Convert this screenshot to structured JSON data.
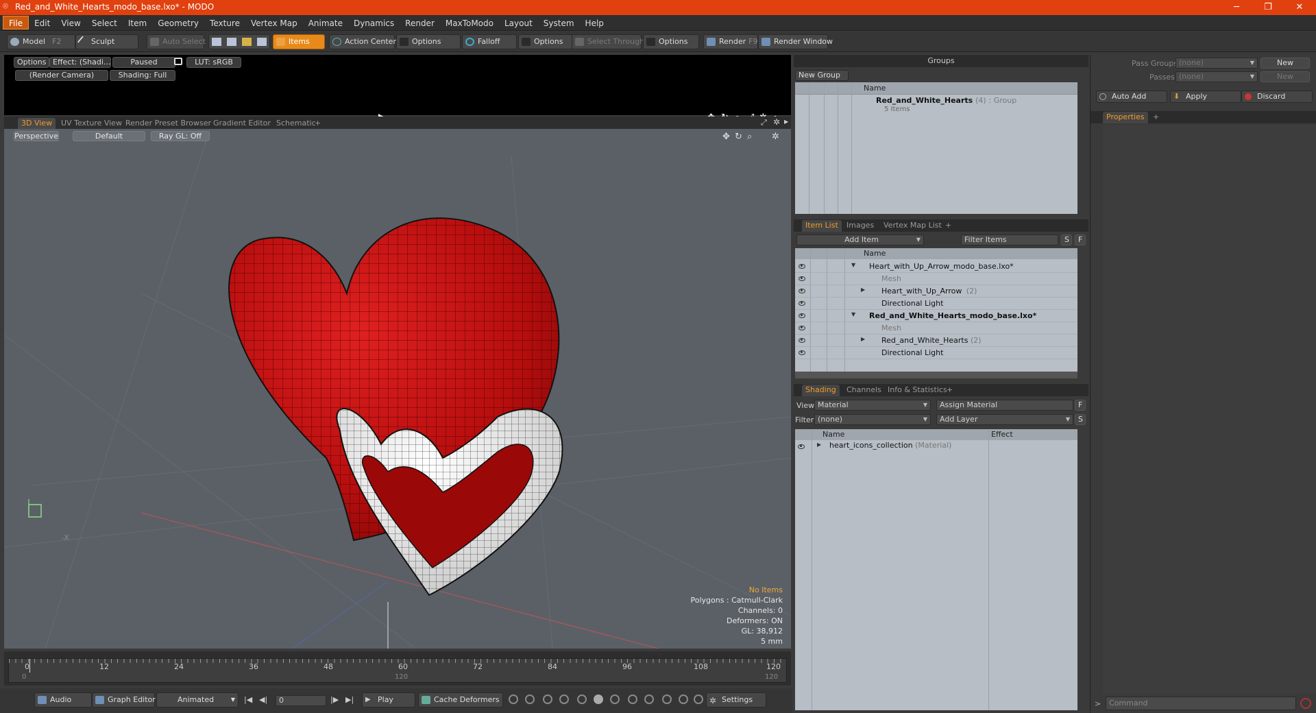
{
  "window": {
    "title": "Red_and_White_Hearts_modo_base.lxo* - MODO",
    "logo": "⌾",
    "controls": [
      "─",
      "❐",
      "✕"
    ]
  },
  "menu": [
    "File",
    "Edit",
    "View",
    "Select",
    "Item",
    "Geometry",
    "Texture",
    "Vertex Map",
    "Animate",
    "Dynamics",
    "Render",
    "MaxToModo",
    "Layout",
    "System",
    "Help"
  ],
  "toolbar": {
    "model": "Model",
    "model_key": "F2",
    "sculpt": "Sculpt",
    "auto_select": "Auto Select",
    "items": "Items",
    "action_center": "Action Center",
    "options1": "Options",
    "falloff": "Falloff",
    "options2": "Options",
    "select_through": "Select Through",
    "options3": "Options",
    "render": "Render",
    "render_key": "F9",
    "render_window": "Render Window"
  },
  "preview": {
    "options": "Options",
    "effect": "Effect: (Shadi...",
    "paused": "Paused",
    "lut": "LUT: sRGB",
    "camera": "(Render Camera)",
    "shading": "Shading: Full"
  },
  "viewtabs": [
    "3D View",
    "UV Texture View",
    "Render Preset Browser",
    "Gradient Editor",
    "Schematic",
    "+"
  ],
  "viewport": {
    "perspective": "Perspective",
    "default": "Default",
    "raygl": "Ray GL: Off",
    "axis_x": "-X"
  },
  "stats": {
    "noitems": "No Items",
    "polygons": "Polygons : Catmull-Clark",
    "channels": "Channels: 0",
    "deformers": "Deformers: ON",
    "gl": "GL: 38,912",
    "scale": "5 mm"
  },
  "timeline": {
    "ticks": [
      "0",
      "12",
      "24",
      "36",
      "48",
      "60",
      "72",
      "84",
      "96",
      "108",
      "120"
    ],
    "sub_start": "0",
    "sub_mid": "120",
    "sub_end": "120"
  },
  "bottom": {
    "audio": "Audio",
    "graph_editor": "Graph Editor",
    "animated": "Animated",
    "frame": "0",
    "play": "Play",
    "cache": "Cache Deformers",
    "settings": "Settings"
  },
  "groups": {
    "title": "Groups",
    "new_group": "New Group",
    "col_name": "Name",
    "item_name": "Red_and_White_Hearts",
    "item_count": "(4)",
    "item_type": ": Group",
    "item_sub": "5 Items"
  },
  "pass": {
    "pass_groups": "Pass Groups",
    "passes": "Passes",
    "none1": "(none)",
    "none2": "(none)",
    "new1": "New",
    "new2": "New",
    "auto_add": "Auto Add",
    "apply": "Apply",
    "discard": "Discard",
    "properties": "Properties",
    "plus": "+"
  },
  "itemlist": {
    "tabs": [
      "Item List",
      "Images",
      "Vertex Map List",
      "+"
    ],
    "add_item": "Add Item",
    "filter": "Filter Items",
    "s": "S",
    "f": "F",
    "col_name": "Name",
    "rows": [
      {
        "label": "Heart_with_Up_Arrow_modo_base.lxo*",
        "bold": false,
        "indent": 0
      },
      {
        "label": "Mesh",
        "bold": false,
        "indent": 1,
        "dim": true
      },
      {
        "label": "Heart_with_Up_Arrow",
        "count": "(2)",
        "bold": false,
        "indent": 1
      },
      {
        "label": "Directional Light",
        "bold": false,
        "indent": 1
      },
      {
        "label": "Red_and_White_Hearts_modo_base.lxo*",
        "bold": true,
        "indent": 0
      },
      {
        "label": "Mesh",
        "bold": false,
        "indent": 1,
        "dim": true
      },
      {
        "label": "Red_and_White_Hearts",
        "count": "(2)",
        "bold": false,
        "indent": 1
      },
      {
        "label": "Directional Light",
        "bold": false,
        "indent": 1
      }
    ]
  },
  "shading": {
    "tabs": [
      "Shading",
      "Channels",
      "Info & Statistics",
      "+"
    ],
    "view_lbl": "View",
    "view_val": "Material",
    "assign": "Assign Material",
    "filter_lbl": "Filter",
    "filter_val": "(none)",
    "add_layer": "Add Layer",
    "f": "F",
    "s": "S",
    "col_name": "Name",
    "col_effect": "Effect",
    "item": "heart_icons_collection",
    "item_type": "(Material)"
  },
  "command": {
    "placeholder": "Command",
    "arrow": ">"
  },
  "colors": {
    "accent": "#f39a2a",
    "title": "#e0410f",
    "heart_red": "#c81414",
    "heart_white": "#e8e8e8"
  }
}
